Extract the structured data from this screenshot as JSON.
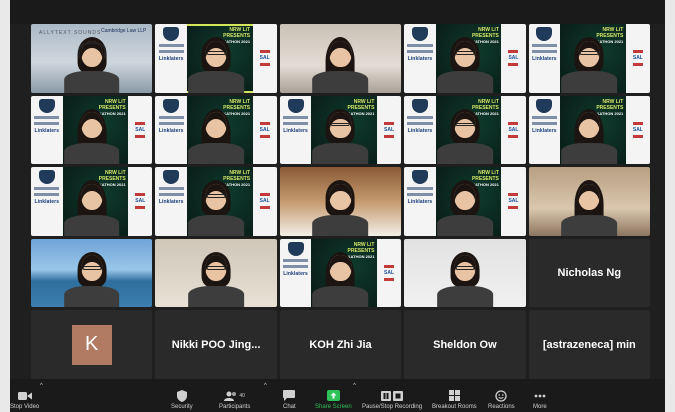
{
  "tiles": [
    {
      "kind": "video",
      "bg": "bg-office",
      "person": "headphones",
      "label": "Cambridge Law LLP",
      "extra": "ALLYTEXT SOUNDS"
    },
    {
      "kind": "poster",
      "active": true,
      "person": "glasses"
    },
    {
      "kind": "video",
      "bg": "bg-room",
      "person": "long"
    },
    {
      "kind": "poster",
      "person": "glasses"
    },
    {
      "kind": "poster",
      "person": "glasses"
    },
    {
      "kind": "poster",
      "person": "long"
    },
    {
      "kind": "poster",
      "person": "long"
    },
    {
      "kind": "poster",
      "person": "glasses"
    },
    {
      "kind": "poster",
      "person": "glasses"
    },
    {
      "kind": "poster",
      "person": "long"
    },
    {
      "kind": "poster",
      "person": "long"
    },
    {
      "kind": "poster",
      "person": "glasses"
    },
    {
      "kind": "video",
      "bg": "bg-wood",
      "person": "plain"
    },
    {
      "kind": "poster",
      "person": "plain"
    },
    {
      "kind": "video",
      "bg": "bg-home",
      "person": "long"
    },
    {
      "kind": "video",
      "bg": "bg-sea",
      "person": "glasses"
    },
    {
      "kind": "video",
      "bg": "bg-warm",
      "person": "glasses"
    },
    {
      "kind": "poster",
      "person": "long"
    },
    {
      "kind": "video",
      "bg": "bg-light",
      "person": "glasses"
    },
    {
      "kind": "name",
      "name": "Nicholas Ng"
    },
    {
      "kind": "avatar",
      "initial": "K"
    },
    {
      "kind": "name",
      "name": "Nikki POO Jing..."
    },
    {
      "kind": "name",
      "name": "KOH Zhi Jia"
    },
    {
      "kind": "name",
      "name": "Sheldon Ow"
    },
    {
      "kind": "name",
      "name": "[astrazeneca] min"
    }
  ],
  "poster": {
    "title_line1": "NRW LiT",
    "title_line2": "PRESENTS",
    "title_sub": "HACKATHON 2021",
    "brand": "Linklaters",
    "side_logo": "SAL"
  },
  "toolbar": {
    "stop_video": "Stop Video",
    "security": "Security",
    "participants": "Participants",
    "participants_count": "40",
    "chat": "Chat",
    "share_screen": "Share Screen",
    "record": "Pause/Stop Recording",
    "breakout": "Breakout Rooms",
    "reactions": "Reactions",
    "more": "More"
  },
  "colors": {
    "share": "#2fc15a",
    "active_outline": "#d4e65a",
    "avatar": "#b07a63"
  }
}
